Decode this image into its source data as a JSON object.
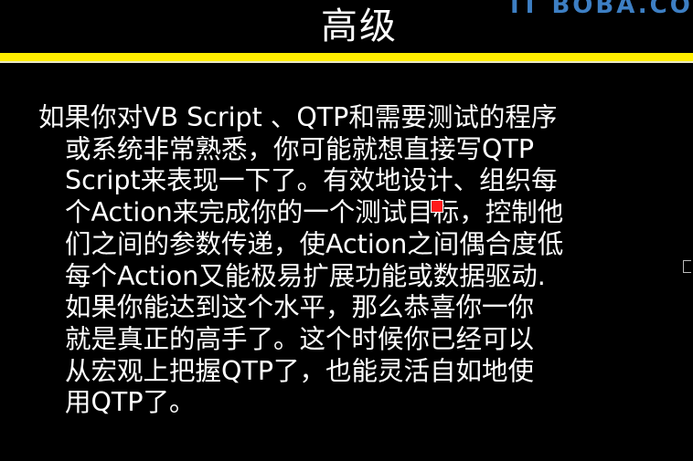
{
  "slide": {
    "title": "高级",
    "watermark": "IT BOBA.COM",
    "body_lines": [
      "如果你对VB Script 、QTP和需要测试的程序",
      "或系统非常熟悉，你可能就想直接写QTP",
      "Script来表现一下了。有效地设计、组织每",
      "个Action来完成你的一个测试目标，控制他",
      "们之间的参数传递，使Action之间偶合度低",
      "每个Action又能极易扩展功能或数据驱动.",
      "如果你能达到这个水平，那么恭喜你一你",
      "就是真正的高手了。这个时候你已经可以",
      "从宏观上把握QTP了，也能灵活自如地使",
      "用QTP了。"
    ]
  },
  "colors": {
    "background": "#000000",
    "text": "#ffffff",
    "title_rule": "#ffee00",
    "watermark": "#3d7fc4",
    "pointer_marker": "#ff1a1a"
  }
}
